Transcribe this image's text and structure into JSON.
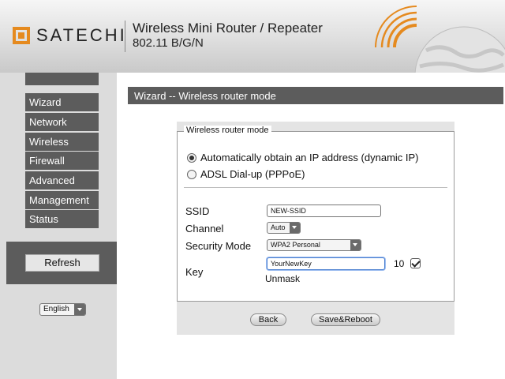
{
  "header": {
    "brand": "SATECHI",
    "product_title": "Wireless Mini Router / Repeater",
    "product_subtitle": "802.11 B/G/N"
  },
  "sidebar": {
    "items": [
      {
        "label": "Wizard"
      },
      {
        "label": "Network"
      },
      {
        "label": "Wireless"
      },
      {
        "label": "Firewall"
      },
      {
        "label": "Advanced"
      },
      {
        "label": "Management"
      },
      {
        "label": "Status"
      }
    ],
    "refresh_label": "Refresh",
    "language": "English"
  },
  "main": {
    "title": "Wizard -- Wireless router mode",
    "legend": "Wireless router mode",
    "options": [
      {
        "label": "Automatically obtain an IP address (dynamic IP)",
        "checked": true
      },
      {
        "label": "ADSL Dial-up (PPPoE)",
        "checked": false
      }
    ],
    "ssid": {
      "label": "SSID",
      "value": "NEW-SSID"
    },
    "channel": {
      "label": "Channel",
      "value": "Auto"
    },
    "security": {
      "label": "Security Mode",
      "value": "WPA2 Personal"
    },
    "key": {
      "label": "Key",
      "value": "YourNewKey",
      "length": "10",
      "unmask_label": "Unmask",
      "unmask_checked": true
    },
    "back_label": "Back",
    "save_label": "Save&Reboot"
  },
  "colors": {
    "brand_orange": "#e58a1f",
    "nav_gray": "#5c5c5c",
    "panel_gray": "#e4e4e4"
  }
}
